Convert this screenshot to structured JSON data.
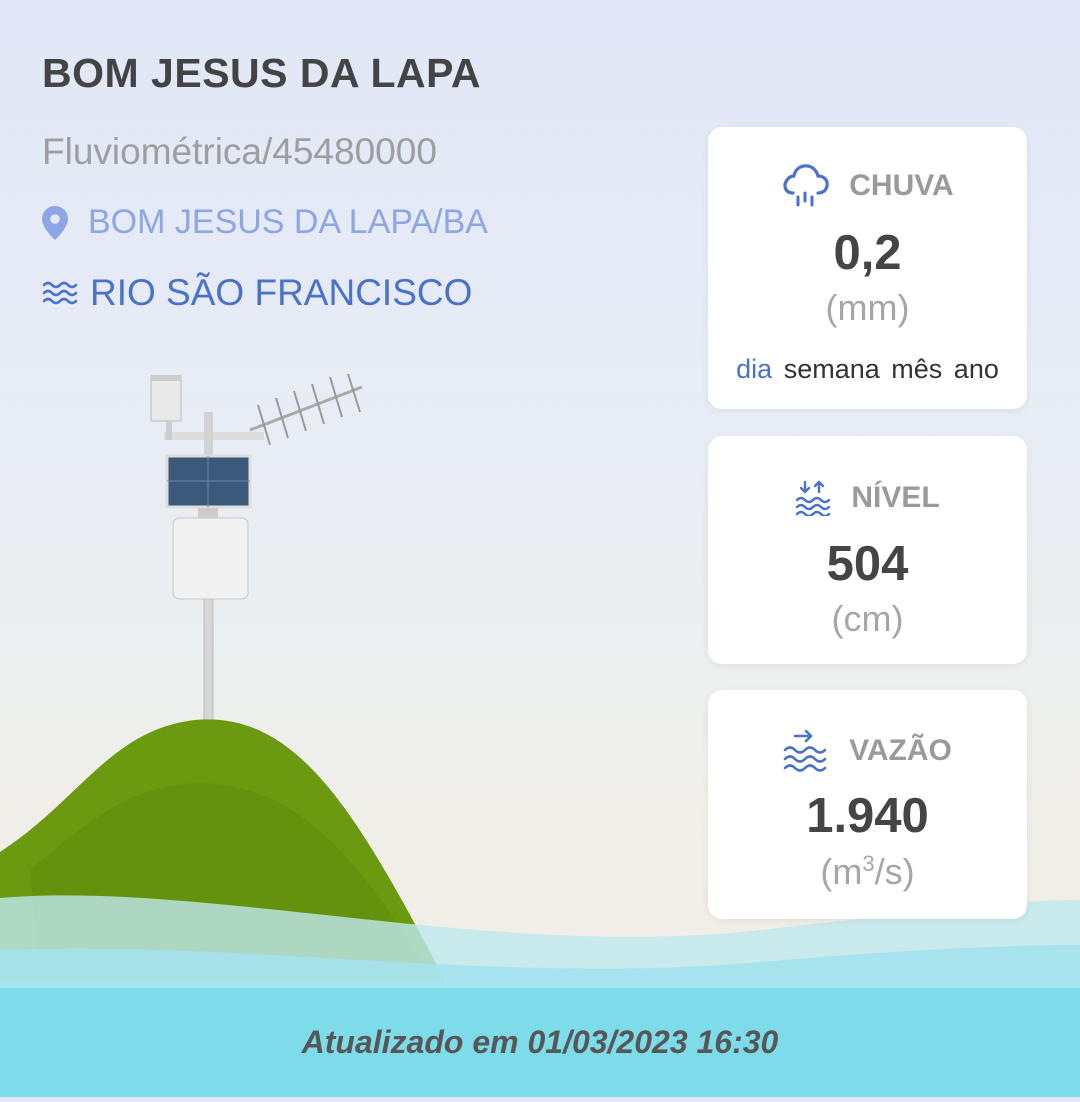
{
  "station": {
    "name": "BOM JESUS DA LAPA",
    "code": "Fluviométrica/45480000",
    "location": "BOM JESUS DA LAPA/BA",
    "river": "RIO SÃO FRANCISCO"
  },
  "cards": {
    "chuva": {
      "label": "CHUVA",
      "value": "0,2",
      "unit": "(mm)",
      "icon": "rain-cloud-icon",
      "periods": [
        "dia",
        "semana",
        "mês",
        "ano"
      ],
      "active_period": "dia"
    },
    "nivel": {
      "label": "NÍVEL",
      "value": "504",
      "unit": "(cm)",
      "icon": "water-level-icon"
    },
    "vazao": {
      "label": "VAZÃO",
      "value": "1.940",
      "unit_prefix": "(m",
      "unit_sup": "3",
      "unit_suffix": "/s)",
      "icon": "water-flow-icon"
    }
  },
  "footer": {
    "updated": "Atualizado em 01/03/2023 16:30"
  },
  "colors": {
    "accent": "#4a72cc",
    "location": "#8fa6e6",
    "footer_bg": "#7ddbea",
    "hill": "#6b9a10"
  }
}
